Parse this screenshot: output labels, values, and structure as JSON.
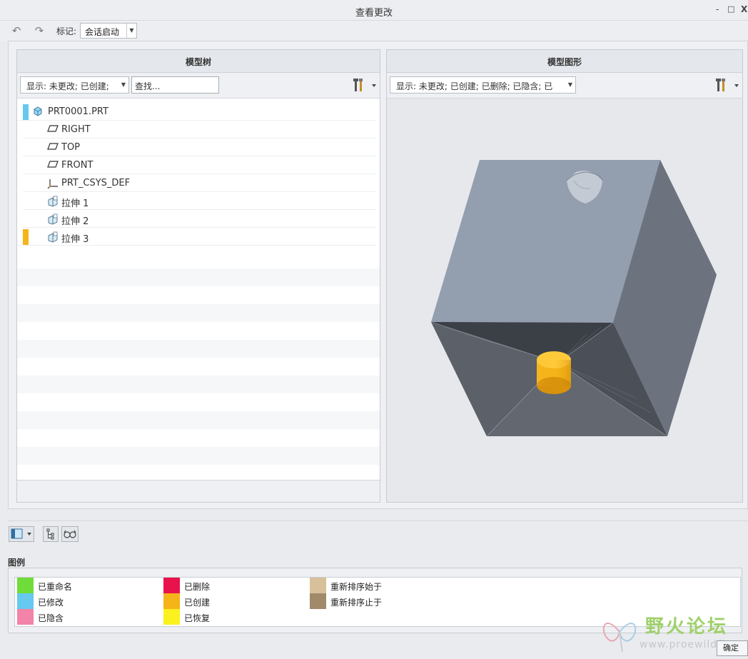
{
  "window": {
    "title": "查看更改",
    "controls": [
      "-",
      "□",
      "X"
    ]
  },
  "toolbar": {
    "mark_label": "标记:",
    "mark_value": "会话启动"
  },
  "model_tree": {
    "title": "模型树",
    "display_filter": "显示: 未更改; 已创建;",
    "search_placeholder": "查找...",
    "items": [
      {
        "label": "PRT0001.PRT",
        "icon": "part-icon",
        "status": "modified"
      },
      {
        "label": "RIGHT",
        "icon": "datum-plane-icon",
        "status": ""
      },
      {
        "label": "TOP",
        "icon": "datum-plane-icon",
        "status": ""
      },
      {
        "label": "FRONT",
        "icon": "datum-plane-icon",
        "status": ""
      },
      {
        "label": "PRT_CSYS_DEF",
        "icon": "coordinate-system-icon",
        "status": ""
      },
      {
        "label": "拉伸 1",
        "icon": "extrude-icon",
        "status": ""
      },
      {
        "label": "拉伸 2",
        "icon": "extrude-icon",
        "status": ""
      },
      {
        "label": "拉伸 3",
        "icon": "extrude-icon",
        "status": "created"
      }
    ]
  },
  "model_graphics": {
    "title": "模型图形",
    "display_filter": "显示: 未更改; 已创建; 已删除; 已隐含; 已"
  },
  "legend": {
    "title": "图例",
    "items": [
      {
        "label": "已重命名",
        "color": "#6fdc3a"
      },
      {
        "label": "已修改",
        "color": "#66c9ef"
      },
      {
        "label": "已隐含",
        "color": "#f184a8"
      },
      {
        "label": "已删除",
        "color": "#e8124d"
      },
      {
        "label": "已创建",
        "color": "#f5b418"
      },
      {
        "label": "已恢复",
        "color": "#faf11e"
      },
      {
        "label": "重新排序始于",
        "color": "#d8c09a"
      },
      {
        "label": "重新排序止于",
        "color": "#a18a6a"
      }
    ]
  },
  "watermark": {
    "text": "野火论坛",
    "url": "www.proewildfire"
  },
  "ok_button": "确定",
  "colors": {
    "created": "#f5b418",
    "modified": "#66c9ef"
  }
}
